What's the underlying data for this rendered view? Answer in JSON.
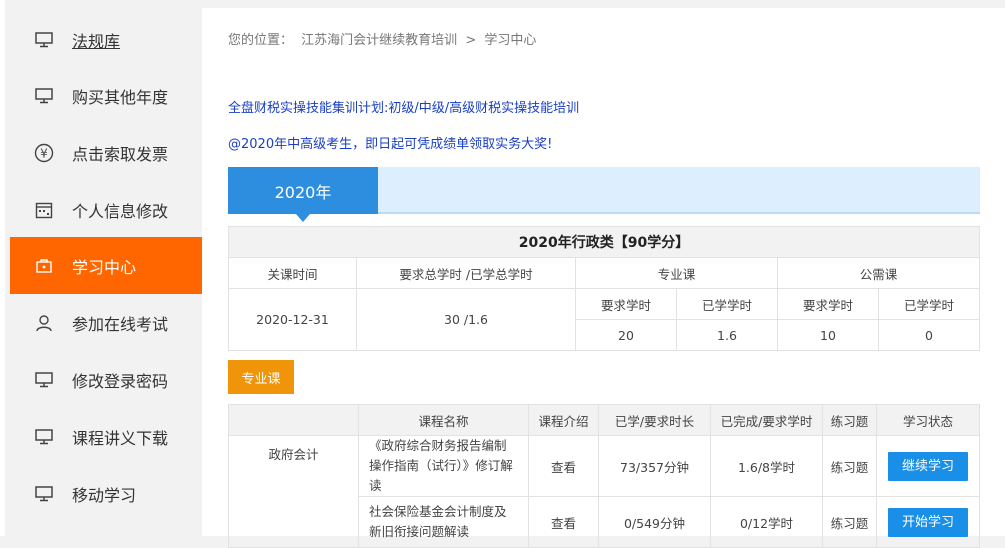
{
  "sidebar": {
    "items": [
      {
        "label": "法规库",
        "icon": "monitor-icon"
      },
      {
        "label": "购买其他年度",
        "icon": "monitor-icon"
      },
      {
        "label": "点击索取发票",
        "icon": "yen-icon"
      },
      {
        "label": "个人信息修改",
        "icon": "calendar-icon"
      },
      {
        "label": "学习中心",
        "icon": "briefcase-icon"
      },
      {
        "label": "参加在线考试",
        "icon": "user-icon"
      },
      {
        "label": "修改登录密码",
        "icon": "monitor-icon"
      },
      {
        "label": "课程讲义下载",
        "icon": "monitor-icon"
      },
      {
        "label": "移动学习",
        "icon": "monitor-icon"
      }
    ],
    "active_color": "#ff6600"
  },
  "breadcrumb": {
    "prefix": "您的位置：",
    "site": "江苏海门会计继续教育培训",
    "sep": ">",
    "current": "学习中心"
  },
  "promo": {
    "line1": "全盘财税实操技能集训计划:初级/中级/高级财税实操技能培训",
    "line2": "@2020年中高级考生，即日起可凭成绩单领取实务大奖!"
  },
  "year_tab": "2020年",
  "summary": {
    "title": "2020年行政类【90学分】",
    "headers": {
      "close_time": "关课时间",
      "total_hours": "要求总学时 /已学总学时",
      "professional": "专业课",
      "public": "公需课",
      "req_hours": "要求学时",
      "done_hours": "已学学时"
    },
    "values": {
      "close_time": "2020-12-31",
      "total_hours": "30 /1.6",
      "prof_req": "20",
      "prof_done": "1.6",
      "pub_req": "10",
      "pub_done": "0"
    }
  },
  "category_button": "专业课",
  "courses": {
    "headers": [
      "",
      "课程名称",
      "课程介绍",
      "已学/要求时长",
      "已完成/要求学时",
      "练习题",
      "学习状态"
    ],
    "category": "政府会计",
    "rows": [
      {
        "name": "《政府综合财务报告编制操作指南（试行）》修订解读",
        "intro": "查看",
        "duration": "73/357分钟",
        "hours": "1.6/8学时",
        "exercise": "练习题",
        "action": "继续学习"
      },
      {
        "name": "社会保险基金会计制度及新旧衔接问题解读",
        "intro": "查看",
        "duration": "0/549分钟",
        "hours": "0/12学时",
        "exercise": "练习题",
        "action": "开始学习"
      }
    ]
  }
}
